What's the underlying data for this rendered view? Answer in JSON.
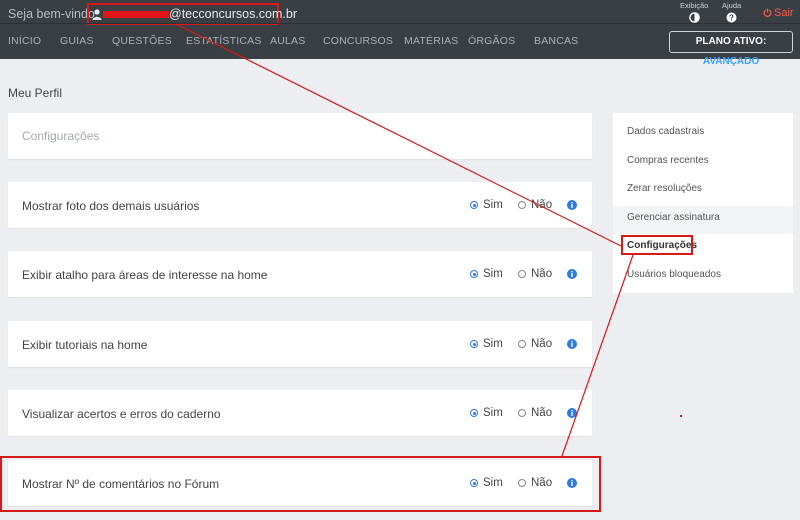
{
  "topbar": {
    "welcome": "Seja bem-vindo,",
    "user_email_domain": "@tecconcursos.com.br",
    "tools": [
      {
        "label": "Exibição",
        "icon": "contrast-icon"
      },
      {
        "label": "Ajuda",
        "icon": "help-icon"
      }
    ],
    "logout": "Sair"
  },
  "nav": {
    "items": [
      "INÍCIO",
      "GUIAS",
      "QUESTÕES",
      "ESTATÍSTICAS",
      "AULAS",
      "CONCURSOS",
      "MATÉRIAS",
      "ÓRGÃOS",
      "BANCAS"
    ],
    "plan_label": "PLANO ATIVO:",
    "plan_value": "AVANÇADO"
  },
  "page": {
    "title": "Meu Perfil",
    "section_title": "Configurações"
  },
  "settings": [
    {
      "label": "Mostrar foto dos demais usuários",
      "yes": "Sim",
      "no": "Não",
      "selected": "yes"
    },
    {
      "label": "Exibir atalho para áreas de interesse na home",
      "yes": "Sim",
      "no": "Não",
      "selected": "yes"
    },
    {
      "label": "Exibir tutoriais na home",
      "yes": "Sim",
      "no": "Não",
      "selected": "yes"
    },
    {
      "label": "Visualizar acertos e erros do caderno",
      "yes": "Sim",
      "no": "Não",
      "selected": "yes"
    },
    {
      "label": "Mostrar Nº de comentários no Fórum",
      "yes": "Sim",
      "no": "Não",
      "selected": "yes"
    }
  ],
  "sidebar": {
    "items": [
      "Dados cadastrais",
      "Compras recentes",
      "Zerar resoluções",
      "Gerenciar assinatura",
      "Configurações",
      "Usuários bloqueados"
    ],
    "active_index": 4
  },
  "colors": {
    "topbar": "#3a3f44",
    "accent_blue": "#3aa0ff",
    "logout_red": "#ff5a4f",
    "annotation_red": "#d61a1a"
  }
}
